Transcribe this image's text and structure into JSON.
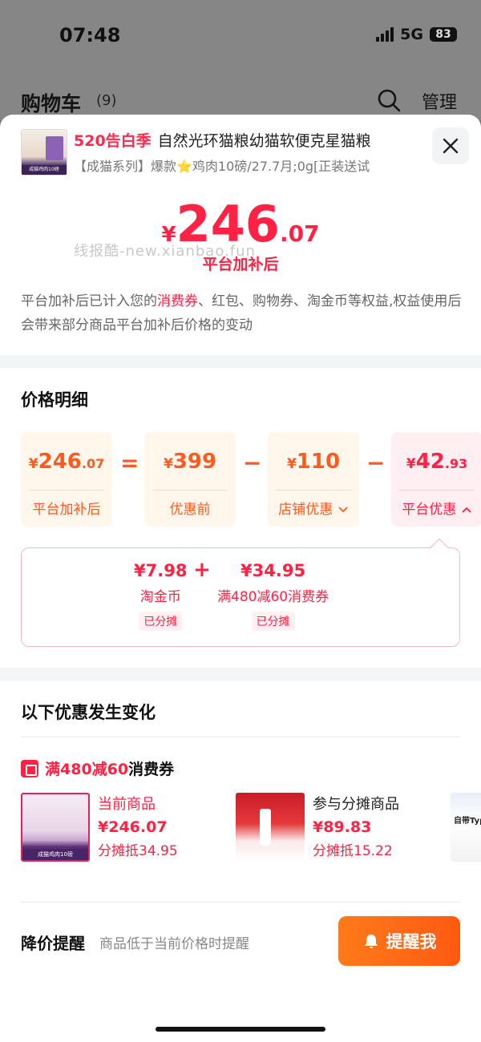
{
  "status": {
    "time": "07:48",
    "network": "5G",
    "battery": "83"
  },
  "background": {
    "title": "购物车",
    "count": "(9)",
    "manage_label": "管理",
    "search_icon": "search-icon"
  },
  "product": {
    "promo_tag": "520告白季",
    "name": "自然光环猫粮幼猫软便克星猫粮",
    "spec": "【成猫系列】爆款⭐鸡肉10磅/27.7月;0g[正装送试",
    "thumb_band": "成猫鸡肉10磅"
  },
  "price": {
    "yen": "¥",
    "integer": "246",
    "decimal": ".07",
    "label": "平台加补后"
  },
  "watermark": "线报酷-new.xianbao.fun",
  "description": {
    "part1": "平台加补后已计入您的",
    "highlight": "消费券",
    "part2": "、红包、购物券、淘金币等权益,权益使用后会带来部分商品平台加补后价格的变动"
  },
  "price_detail": {
    "title": "价格明细",
    "cards": [
      {
        "yen": "¥",
        "int": "246",
        "dec": ".07",
        "label": "平台加补后"
      },
      {
        "yen": "¥",
        "int": "399",
        "dec": "",
        "label": "优惠前"
      },
      {
        "yen": "¥",
        "int": "110",
        "dec": "",
        "label": "店铺优惠"
      },
      {
        "yen": "¥",
        "int": "42",
        "dec": ".93",
        "label": "平台优惠"
      }
    ],
    "ops": [
      "=",
      "−",
      "−"
    ],
    "breakdown": [
      {
        "value": "¥7.98",
        "label": "淘金币",
        "badge": "已分摊"
      },
      {
        "value": "¥34.95",
        "label": "满480减60消费券",
        "badge": "已分摊"
      }
    ],
    "plus": "+"
  },
  "changes": {
    "title": "以下优惠发生变化",
    "coupon_red": "满480减60",
    "coupon_tail": "消费券",
    "goods": [
      {
        "tag": "当前商品",
        "price": "¥246.07",
        "share": "分摊抵34.95",
        "image_band": "成猫鸡肉10磅"
      },
      {
        "tag": "参与分摊商品",
        "price": "¥89.83",
        "share": "分摊抵15.22"
      },
      {
        "partial_text": "自带Type-"
      }
    ]
  },
  "reminder": {
    "title": "降价提醒",
    "desc": "商品低于当前价格时提醒",
    "button": "提醒我"
  },
  "colors": {
    "accent_red": "#ff2244",
    "accent_orange": "#ff5a1f",
    "button_orange": "#ff6a14"
  }
}
